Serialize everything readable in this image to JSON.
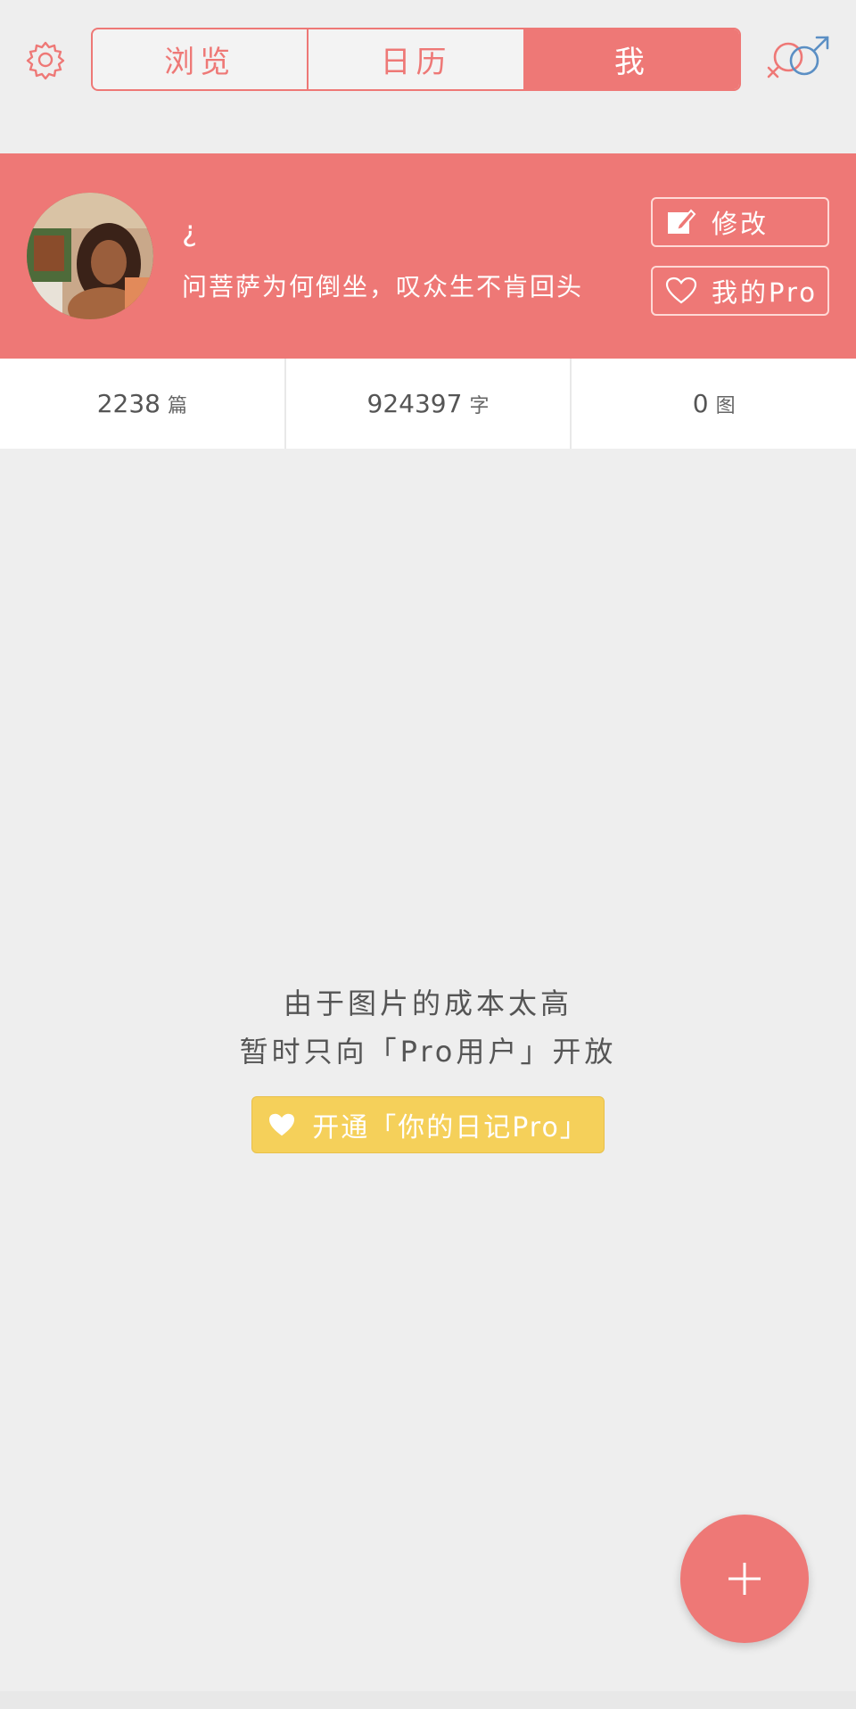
{
  "header": {
    "tabs": [
      {
        "label": "浏览",
        "active": false
      },
      {
        "label": "日历",
        "active": false
      },
      {
        "label": "我",
        "active": true
      }
    ],
    "settings_icon": "gear-icon",
    "gender_icon": "gender-symbol-icon",
    "accent_color": "#ee7876"
  },
  "profile": {
    "nickname": "¿",
    "signature": "问菩萨为何倒坐，叹众生不肯回头",
    "edit_label": "修改",
    "pro_label": "我的Pro",
    "edit_icon": "edit-icon",
    "pro_icon": "heart-outline-icon"
  },
  "stats": [
    {
      "value": "2238",
      "unit": "篇"
    },
    {
      "value": "924397",
      "unit": "字"
    },
    {
      "value": "0",
      "unit": "图"
    }
  ],
  "content": {
    "notice_line1": "由于图片的成本太高",
    "notice_line2": "暂时只向「Pro用户」开放",
    "unlock_label": "开通「你的日记Pro」",
    "unlock_color": "#f5d05a"
  },
  "fab": {
    "icon": "plus-icon"
  }
}
